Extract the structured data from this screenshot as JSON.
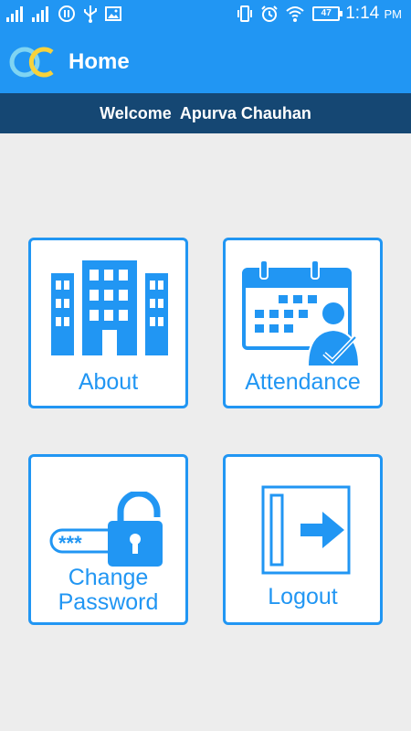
{
  "status_bar": {
    "battery": "47",
    "time": "1:14",
    "ampm": "PM"
  },
  "app_bar": {
    "title": "Home"
  },
  "welcome": {
    "prefix": "Welcome",
    "user_name": "Apurva Chauhan"
  },
  "tiles": {
    "about": {
      "label": "About"
    },
    "attendance": {
      "label": "Attendance"
    },
    "change_password": {
      "line1": "Change",
      "line2": "Password"
    },
    "logout": {
      "label": "Logout"
    }
  },
  "colors": {
    "primary": "#2196F3",
    "banner": "#154773",
    "background": "#EDEDED"
  }
}
